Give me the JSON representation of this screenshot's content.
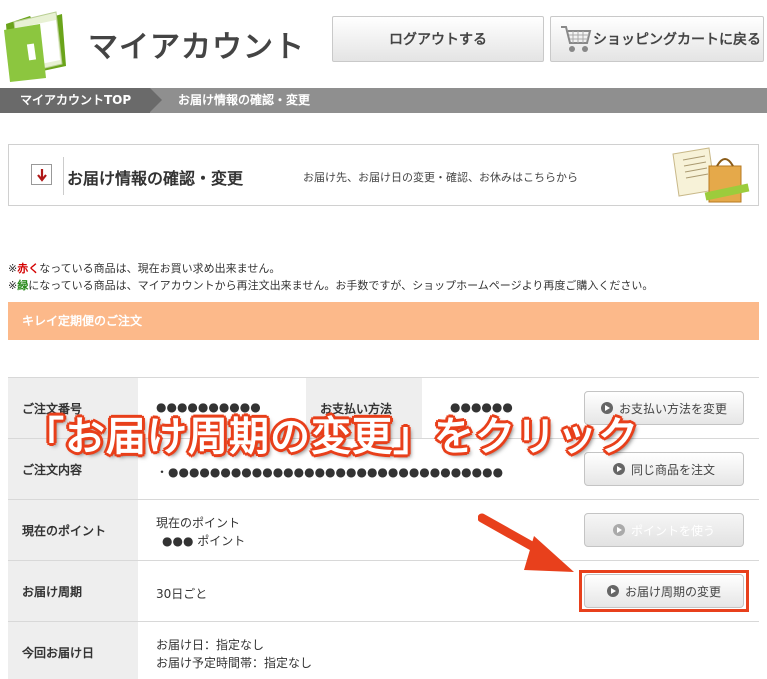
{
  "header": {
    "title": "マイアカウント",
    "logout_label": "ログアウトする",
    "cart_label": "ショッピングカートに戻る",
    "logo_icon": "folder-icon",
    "cart_icon": "shopping-cart-icon"
  },
  "breadcrumb": {
    "items": [
      "マイアカウントTOP",
      "お届け情報の確認・変更"
    ]
  },
  "section": {
    "title": "お届け情報の確認・変更",
    "description": "お届け先、お届け日の変更・確認、お休みはこちらから",
    "arrow_icon": "arrow-down-icon"
  },
  "notes": {
    "note1_prefix": "※",
    "note1_highlight": "赤く",
    "note1_rest": "なっている商品は、現在お買い求め出来ません。",
    "note2_prefix": "※",
    "note2_highlight": "緑",
    "note2_rest": "になっている商品は、マイアカウントから再注文出来ません。お手数ですが、ショップホームページより再度ご購入ください。"
  },
  "order_section": {
    "title": "キレイ定期便のご注文"
  },
  "table": {
    "rows": [
      {
        "label": "ご注文番号",
        "value": "●●●●●●●●●●",
        "label2": "お支払い方法",
        "value2": "●●●●●●",
        "button": "お支払い方法を変更"
      },
      {
        "label": "ご注文内容",
        "value": "・●●●●●●●●●●●●●●●●●●●●●●●●●●●●●●●●",
        "button": "同じ商品を注文"
      },
      {
        "label": "現在のポイント",
        "value_line1": "現在のポイント",
        "value_line2": "●●● ポイント",
        "button": "ポイントを使う"
      },
      {
        "label": "お届け周期",
        "value": "30日ごと",
        "button": "お届け周期の変更"
      },
      {
        "label": "今回お届け日",
        "value_line1": "お届け日：指定なし",
        "value_line2": "お届け予定時間帯：指定なし"
      }
    ]
  },
  "annotation": {
    "text": "「お届け周期の変更」をクリック",
    "color": "#e8401c"
  }
}
